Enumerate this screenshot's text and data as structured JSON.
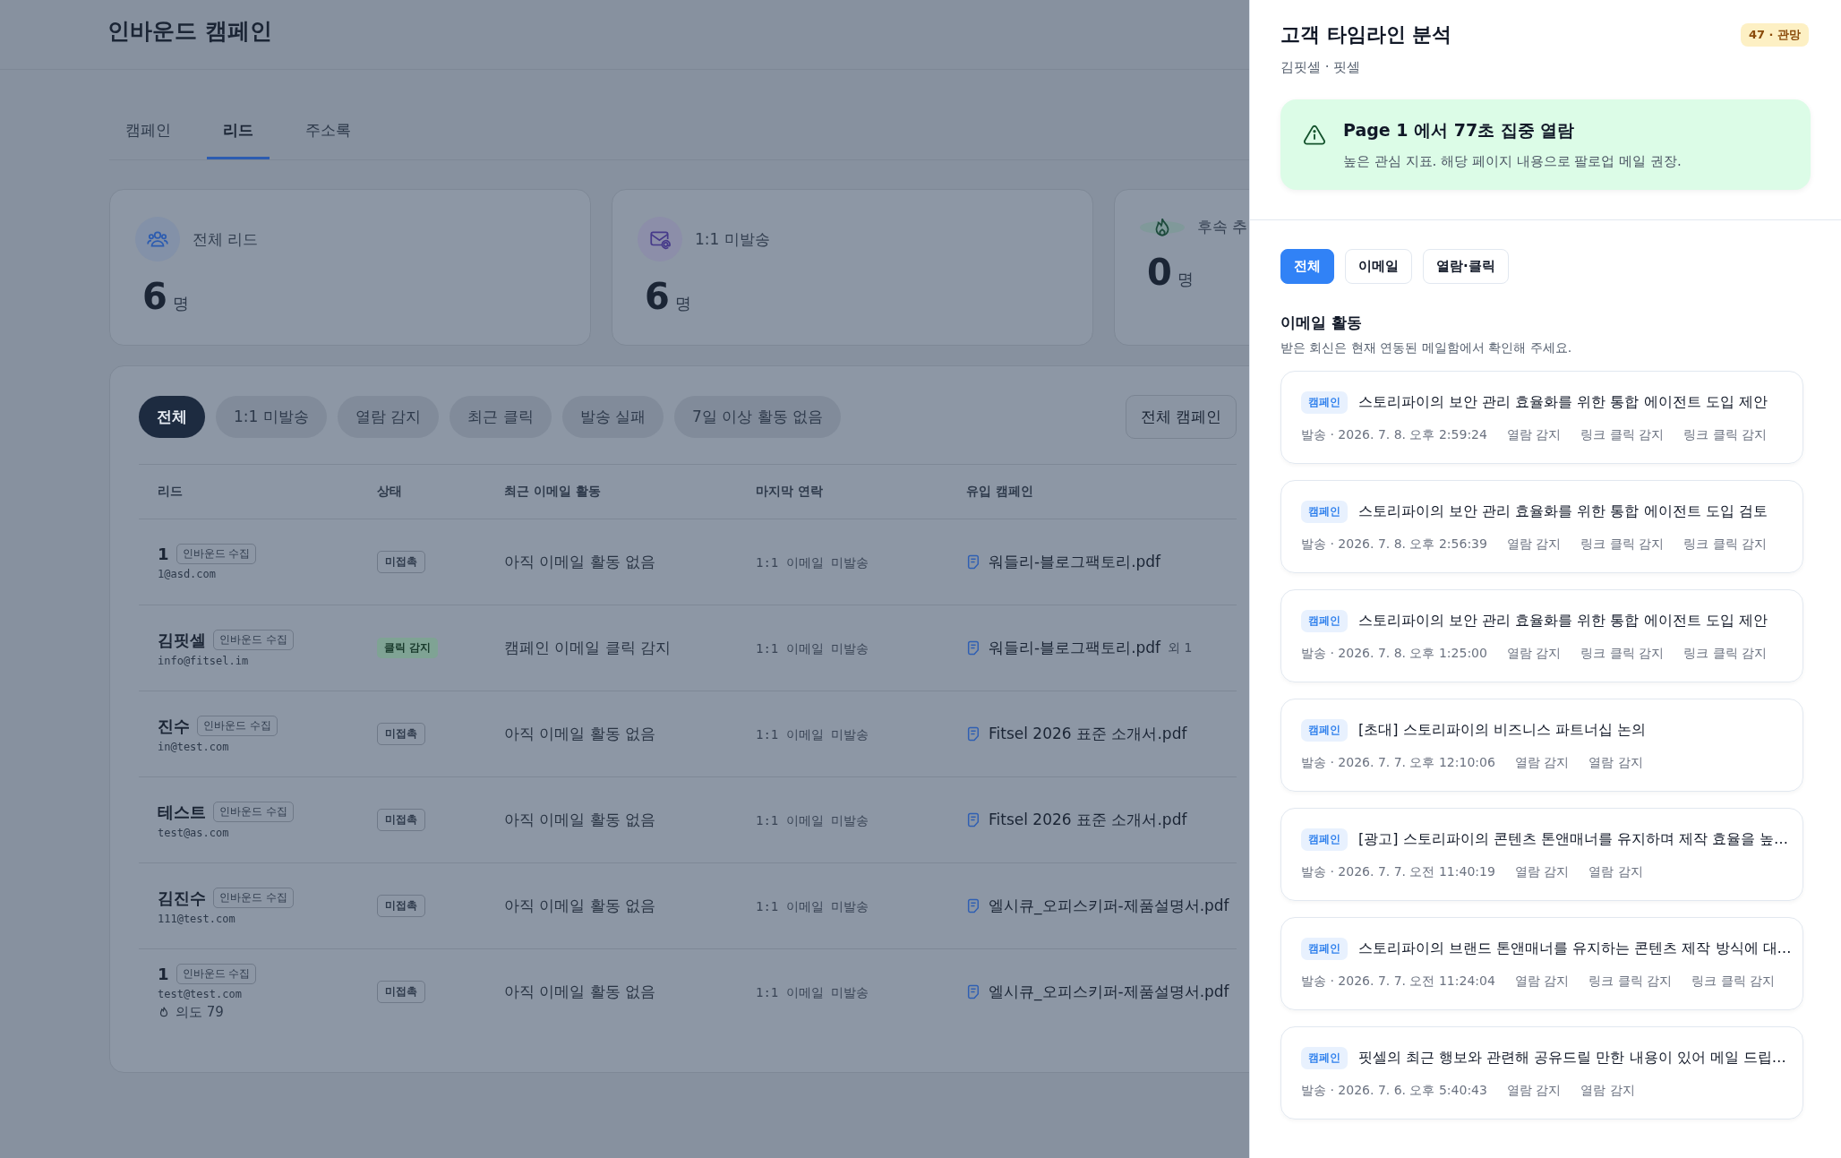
{
  "page": {
    "title": "인바운드 캠페인"
  },
  "tabs": [
    {
      "label": "캠페인",
      "selected": false
    },
    {
      "label": "리드",
      "selected": true
    },
    {
      "label": "주소록",
      "selected": false
    }
  ],
  "stats": [
    {
      "kind": "people",
      "label": "전체 리드",
      "value": "6",
      "unit": "명"
    },
    {
      "kind": "mail",
      "label": "1:1 미발송",
      "value": "6",
      "unit": "명"
    },
    {
      "kind": "flame",
      "label": "후속 추",
      "value": "0",
      "unit": "명"
    }
  ],
  "filters": [
    {
      "label": "전체",
      "selected": true
    },
    {
      "label": "1:1 미발송",
      "selected": false
    },
    {
      "label": "열람 감지",
      "selected": false
    },
    {
      "label": "최근 클릭",
      "selected": false
    },
    {
      "label": "발송 실패",
      "selected": false
    },
    {
      "label": "7일 이상 활동 없음",
      "selected": false
    }
  ],
  "campaign_filter": "전체 캠페인",
  "table": {
    "columns": [
      "리드",
      "상태",
      "최근 이메일 활동",
      "마지막 연락",
      "유입 캠페인"
    ],
    "rows": [
      {
        "name": "1",
        "tag": "인바운드 수집",
        "email": "1@asd.com",
        "status": {
          "label": "미접촉",
          "kind": "none"
        },
        "activity": "아직 이메일 활동 없음",
        "last_contact": "1:1 이메일 미발송",
        "campaign": "워들리-블로그팩토리.pdf"
      },
      {
        "name": "김핏셀",
        "tag": "인바운드 수집",
        "email": "info@fitsel.im",
        "status": {
          "label": "클릭 감지",
          "kind": "click"
        },
        "activity": "캠페인 이메일 클릭 감지",
        "last_contact": "1:1 이메일 미발송",
        "campaign": "워들리-블로그팩토리.pdf",
        "extra": "외 1"
      },
      {
        "name": "진수",
        "tag": "인바운드 수집",
        "email": "in@test.com",
        "status": {
          "label": "미접촉",
          "kind": "none"
        },
        "activity": "아직 이메일 활동 없음",
        "last_contact": "1:1 이메일 미발송",
        "campaign": "Fitsel 2026 표준 소개서.pdf"
      },
      {
        "name": "테스트",
        "tag": "인바운드 수집",
        "email": "test@as.com",
        "status": {
          "label": "미접촉",
          "kind": "none"
        },
        "activity": "아직 이메일 활동 없음",
        "last_contact": "1:1 이메일 미발송",
        "campaign": "Fitsel 2026 표준 소개서.pdf"
      },
      {
        "name": "김진수",
        "tag": "인바운드 수집",
        "email": "111@test.com",
        "status": {
          "label": "미접촉",
          "kind": "none"
        },
        "activity": "아직 이메일 활동 없음",
        "last_contact": "1:1 이메일 미발송",
        "campaign": "엘시큐_오피스키퍼-제품설명서.pdf"
      },
      {
        "name": "1",
        "tag": "인바운드 수집",
        "email": "test@test.com",
        "intent": "의도 79",
        "status": {
          "label": "미접촉",
          "kind": "none"
        },
        "activity": "아직 이메일 활동 없음",
        "last_contact": "1:1 이메일 미발송",
        "campaign": "엘시큐_오피스키퍼-제품설명서.pdf"
      }
    ]
  },
  "panel": {
    "title": "고객 타임라인 분석",
    "badge": "47 · 관망",
    "subtitle": "김핏셀 · 핏셀",
    "alert": {
      "title": "Page 1 에서 77초 집중 열람",
      "text": "높은 관심 지표. 해당 페이지 내용으로 팔로업 메일 권장."
    },
    "tabs": [
      {
        "label": "전체",
        "selected": true
      },
      {
        "label": "이메일",
        "selected": false
      },
      {
        "label": "열람·클릭",
        "selected": false
      }
    ],
    "section_title": "이메일 활동",
    "section_note": "받은 회신은 현재 연동된 메일함에서 확인해 주세요.",
    "emails": [
      {
        "tag": "캠페인",
        "title": "스토리파이의 보안 관리 효율화를 위한 통합 에이전트 도입 제안",
        "sent": "발송 · 2026. 7. 8. 오후 2:59:24",
        "events": [
          "열람 감지",
          "링크 클릭 감지",
          "링크 클릭 감지"
        ]
      },
      {
        "tag": "캠페인",
        "title": "스토리파이의 보안 관리 효율화를 위한 통합 에이전트 도입 검토",
        "sent": "발송 · 2026. 7. 8. 오후 2:56:39",
        "events": [
          "열람 감지",
          "링크 클릭 감지",
          "링크 클릭 감지"
        ]
      },
      {
        "tag": "캠페인",
        "title": "스토리파이의 보안 관리 효율화를 위한 통합 에이전트 도입 제안",
        "sent": "발송 · 2026. 7. 8. 오후 1:25:00",
        "events": [
          "열람 감지",
          "링크 클릭 감지",
          "링크 클릭 감지"
        ]
      },
      {
        "tag": "캠페인",
        "title": "[초대] 스토리파이의 비즈니스 파트너십 논의",
        "sent": "발송 · 2026. 7. 7. 오후 12:10:06",
        "events": [
          "열람 감지",
          "열람 감지"
        ]
      },
      {
        "tag": "캠페인",
        "title": "[광고] 스토리파이의 콘텐츠 톤앤매너를 유지하며 제작 효율을 높…",
        "sent": "발송 · 2026. 7. 7. 오전 11:40:19",
        "events": [
          "열람 감지",
          "열람 감지"
        ]
      },
      {
        "tag": "캠페인",
        "title": "스토리파이의 브랜드 톤앤매너를 유지하는 콘텐츠 제작 방식에 대…",
        "sent": "발송 · 2026. 7. 7. 오전 11:24:04",
        "events": [
          "열람 감지",
          "링크 클릭 감지",
          "링크 클릭 감지"
        ]
      },
      {
        "tag": "캠페인",
        "title": "핏셀의 최근 행보와 관련해 공유드릴 만한 내용이 있어 메일 드립…",
        "sent": "발송 · 2026. 7. 6. 오후 5:40:43",
        "events": [
          "열람 감지",
          "열람 감지"
        ]
      }
    ]
  }
}
